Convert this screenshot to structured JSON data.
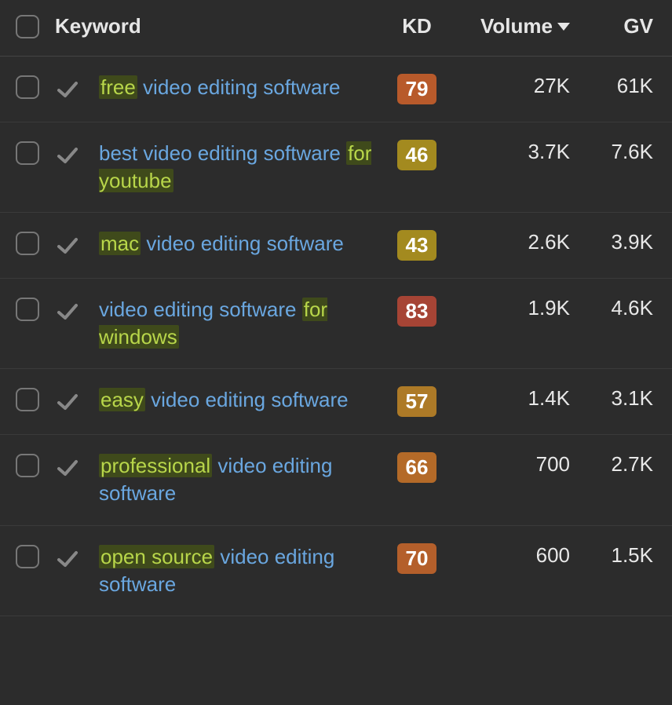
{
  "columns": {
    "keyword": "Keyword",
    "kd": "KD",
    "volume": "Volume",
    "gv": "GV"
  },
  "sort": {
    "column": "volume",
    "direction": "desc"
  },
  "rows": [
    {
      "keyword_parts": [
        {
          "text": "free",
          "hl": true
        },
        {
          "text": " video editing software",
          "hl": false
        }
      ],
      "kd": "79",
      "kd_color": "#b85a2b",
      "volume": "27K",
      "gv": "61K"
    },
    {
      "keyword_parts": [
        {
          "text": "best video editing software ",
          "hl": false
        },
        {
          "text": "for youtube",
          "hl": true
        }
      ],
      "kd": "46",
      "kd_color": "#a38a1f",
      "volume": "3.7K",
      "gv": "7.6K"
    },
    {
      "keyword_parts": [
        {
          "text": "mac",
          "hl": true
        },
        {
          "text": " video editing software",
          "hl": false
        }
      ],
      "kd": "43",
      "kd_color": "#a38a1f",
      "volume": "2.6K",
      "gv": "3.9K"
    },
    {
      "keyword_parts": [
        {
          "text": "video editing software ",
          "hl": false
        },
        {
          "text": "for windows",
          "hl": true
        }
      ],
      "kd": "83",
      "kd_color": "#a64435",
      "volume": "1.9K",
      "gv": "4.6K"
    },
    {
      "keyword_parts": [
        {
          "text": "easy",
          "hl": true
        },
        {
          "text": " video editing software",
          "hl": false
        }
      ],
      "kd": "57",
      "kd_color": "#ad7a27",
      "volume": "1.4K",
      "gv": "3.1K"
    },
    {
      "keyword_parts": [
        {
          "text": "professional",
          "hl": true
        },
        {
          "text": " video editing software",
          "hl": false
        }
      ],
      "kd": "66",
      "kd_color": "#b46a28",
      "volume": "700",
      "gv": "2.7K"
    },
    {
      "keyword_parts": [
        {
          "text": "open source",
          "hl": true
        },
        {
          "text": " video editing software",
          "hl": false
        }
      ],
      "kd": "70",
      "kd_color": "#b45f2b",
      "volume": "600",
      "gv": "1.5K"
    }
  ]
}
